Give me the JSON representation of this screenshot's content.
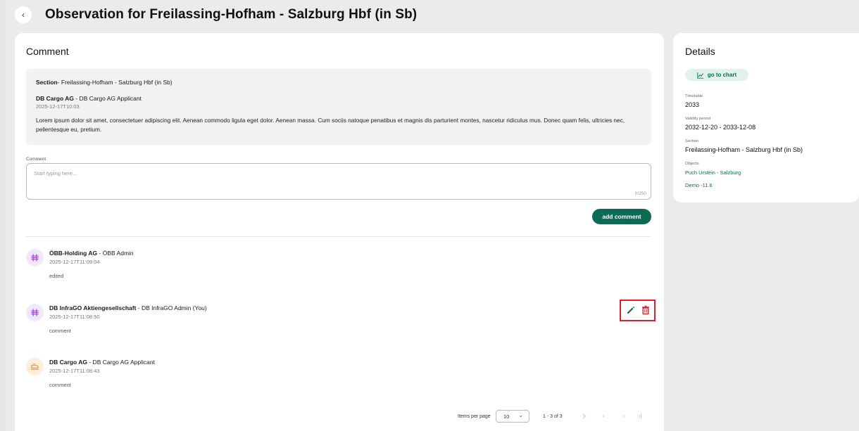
{
  "header": {
    "title": "Observation for Freilassing-Hofham - Salzburg Hbf (in Sb)",
    "back_glyph": "‹"
  },
  "comment_panel": {
    "heading": "Comment",
    "original": {
      "section_label": "Section",
      "section_value": "- Freilassing-Hofham - Salzburg Hbf (in Sb)",
      "author_org": "DB Cargo AG",
      "author_role": " - DB Cargo AG Applicant",
      "date": "2025-12-17T10:03",
      "body": "Lorem ipsum dolor sit amet, consectetuer adipiscing elit. Aenean commodo ligula eget dolor. Aenean massa. Cum sociis natoque penatibus et magnis dis parturient montes, nascetur ridiculus mus. Donec quam felis, ultricies nec, pellentesque eu, pretium."
    },
    "input": {
      "label": "Comment",
      "placeholder": "Start typing here...",
      "value": "",
      "counter": "0/250"
    },
    "add_button_label": "add comment",
    "comments": [
      {
        "org": "ÖBB-Holding AG",
        "role": " - ÖBB Admin",
        "date": "2025-12-17T11:09:04",
        "text": "edited",
        "avatar": "grid-icon"
      },
      {
        "org": "DB InfraGO Aktiengesellschaft",
        "role": " - DB InfraGO Admin  (You)",
        "date": "2025-12-17T11:08:50",
        "text": "comment",
        "avatar": "grid-icon"
      },
      {
        "org": "DB Cargo AG",
        "role": " - DB Cargo AG Applicant",
        "date": "2025-12-17T11:08:43",
        "text": "comment",
        "avatar": "cargo-icon"
      }
    ],
    "pagination": {
      "items_per_page_label": "Items per page",
      "items_per_page_value": "10",
      "range": "1 - 3 of 3",
      "first_glyph": "|‹",
      "prev_glyph": "‹",
      "next_glyph": "›",
      "last_glyph": "›|"
    }
  },
  "details": {
    "heading": "Details",
    "chart_button_label": "go to chart",
    "timetable_label": "Timetable",
    "timetable_value": "2033",
    "validity_label": "Validity period",
    "validity_value": "2032-12-20 - 2033-12-08",
    "section_label": "Section",
    "section_value": "Freilassing-Hofham - Salzburg Hbf (in Sb)",
    "objects_label": "Objects",
    "objects": [
      "Puch Urstein - Salzburg",
      "Demo -11.6"
    ]
  },
  "colors": {
    "primary": "#0d6b54",
    "danger": "#d8212b",
    "avatar_purple": "#a050d8",
    "avatar_orange": "#e6962e"
  }
}
